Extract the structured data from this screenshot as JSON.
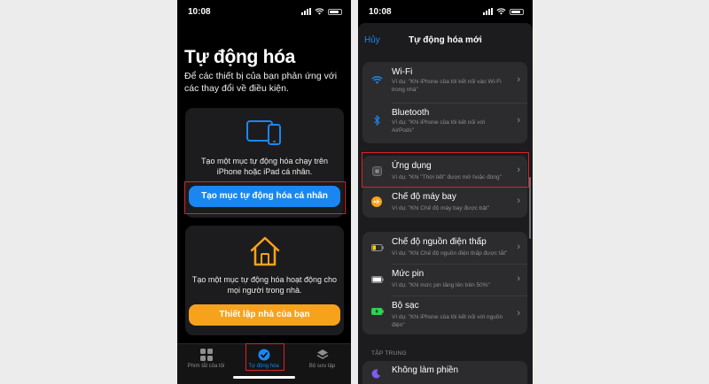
{
  "left": {
    "status_time": "10:08",
    "title": "Tự động hóa",
    "subtitle": "Để các thiết bị của bạn phản ứng với các thay đổi về điều kiện.",
    "personal_card": {
      "text": "Tạo một mục tự động hóa chạy trên iPhone hoặc iPad cá nhân.",
      "button": "Tạo mục tự động hóa cá nhân"
    },
    "home_card": {
      "text": "Tạo một mục tự động hóa hoạt động cho mọi người trong nhà.",
      "button": "Thiết lập nhà của bạn"
    },
    "tabs": [
      {
        "label": "Phím tắt của tôi"
      },
      {
        "label": "Tự động hóa"
      },
      {
        "label": "Bộ sưu tập"
      }
    ]
  },
  "right": {
    "status_time": "10:08",
    "nav": {
      "cancel": "Hủy",
      "title": "Tự động hóa mới"
    },
    "rows": [
      {
        "title": "Wi-Fi",
        "sub": "Ví dụ: \"Khi iPhone của tôi kết nối vào Wi-Fi trong nhà\""
      },
      {
        "title": "Bluetooth",
        "sub": "Ví dụ: \"Khi iPhone của tôi kết nối với AirPods\""
      },
      {
        "title": "Ứng dụng",
        "sub": "Ví dụ: \"Khi \"Thời tiết\" được mở hoặc đóng\""
      },
      {
        "title": "Chế độ máy bay",
        "sub": "Ví dụ: \"Khi Chế độ máy bay được bật\""
      },
      {
        "title": "Chế độ nguồn điện thấp",
        "sub": "Ví dụ: \"Khi Chế độ nguồn điện thấp được tắt\""
      },
      {
        "title": "Mức pin",
        "sub": "Ví dụ: \"Khi mức pin tăng lên trên 50%\""
      },
      {
        "title": "Bộ sạc",
        "sub": "Ví dụ: \"Khi iPhone của tôi kết nối với nguồn điện\""
      },
      {
        "title": "Không làm phiền",
        "sub": ""
      }
    ],
    "section_focus": "TẬP TRUNG"
  },
  "colors": {
    "accent_blue": "#1a87f0",
    "accent_orange": "#f7a21b",
    "highlight_red": "#d8232a"
  }
}
